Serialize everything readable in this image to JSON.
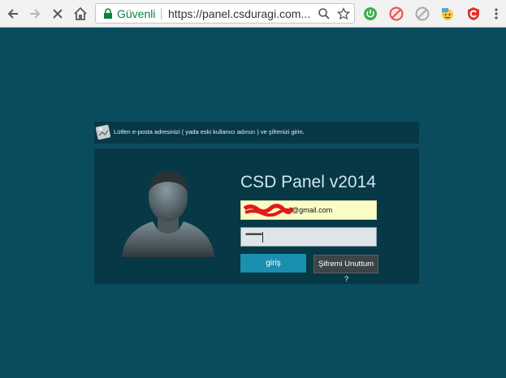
{
  "browser": {
    "secure_label": "Güvenli",
    "url": "https://panel.csduragi.com...",
    "icons": {
      "back": "back-arrow-icon",
      "forward": "forward-arrow-icon",
      "stop": "stop-loading-icon",
      "home": "home-icon",
      "lock": "lock-icon",
      "zoom": "zoom-icon",
      "bookmark": "star-icon"
    },
    "extensions": [
      "green-power-extension-icon",
      "red-blocked-extension-icon",
      "gray-blocked-extension-icon",
      "emoji-extension-icon",
      "red-shield-extension-icon",
      "menu-dots-icon"
    ],
    "colors": {
      "secure": "#0b8043"
    }
  },
  "page": {
    "notice": "Lütfen e-posta adresinizi ( yada eski kullanıcı adınızı ) ve şifrenizi girin.",
    "title": "CSD Panel v2014",
    "email_suffix": "@gmail.com",
    "password_mask": "••••••••",
    "login_label": "giriş",
    "forgot_label": "Şifremi Unuttum",
    "forgot_q": "?",
    "colors": {
      "background": "#0a4c5e",
      "panel": "#073845",
      "login_button": "#1a8fb0",
      "email_bg": "#fbfbc6"
    }
  }
}
